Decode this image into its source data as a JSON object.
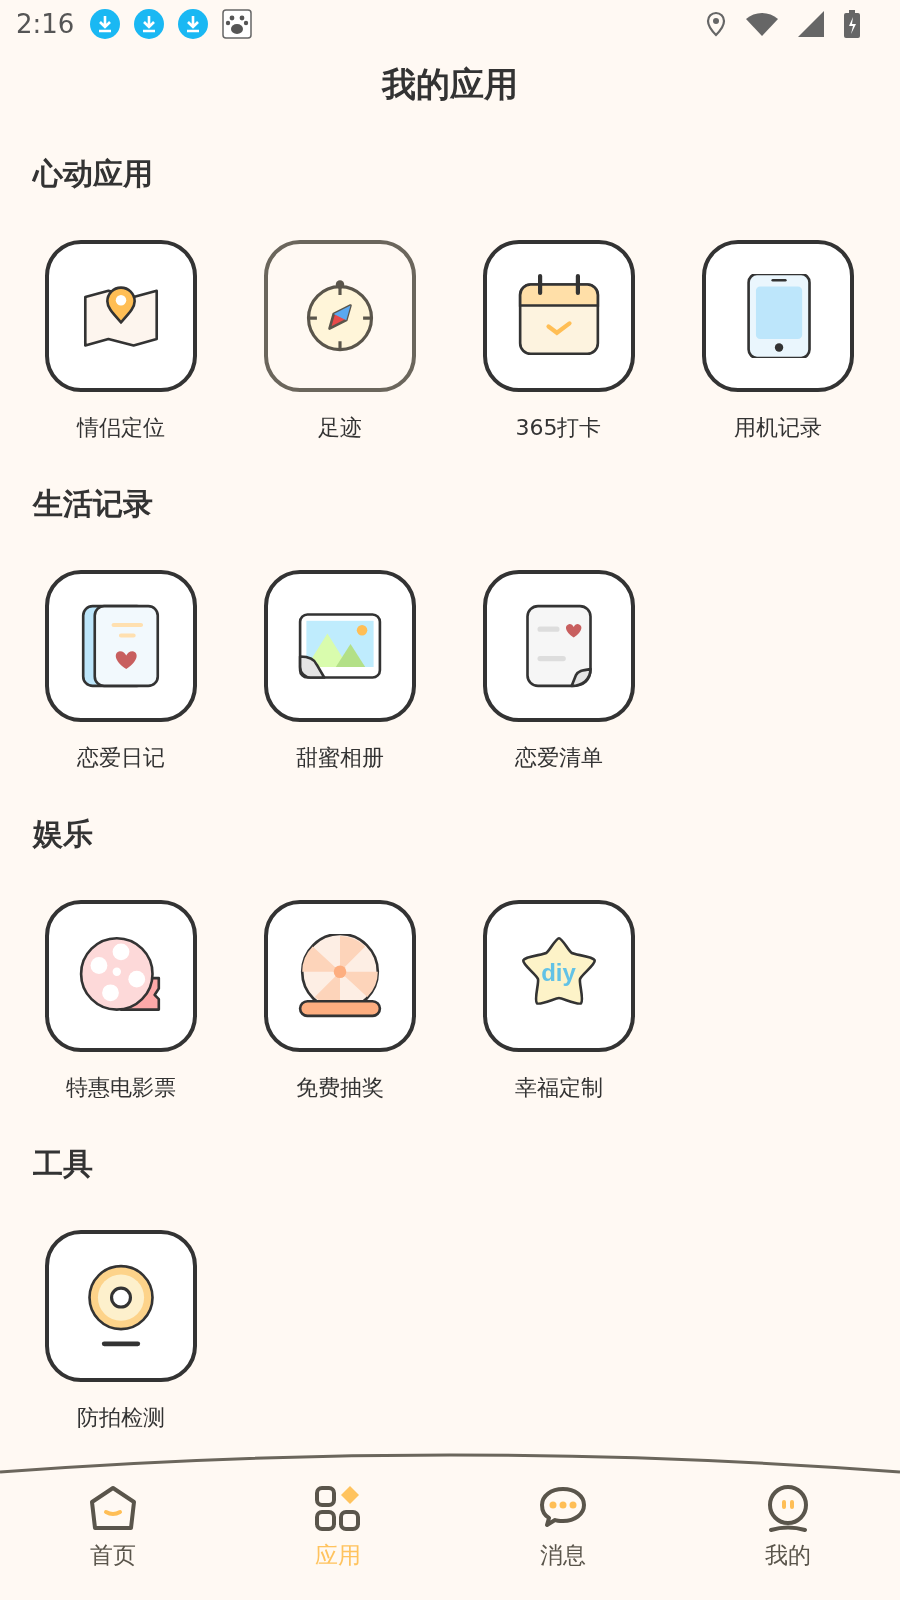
{
  "status_bar": {
    "time": "2:16"
  },
  "title": "我的应用",
  "sections": [
    {
      "title": "心动应用",
      "apps": [
        {
          "label": "情侣定位",
          "pressed": false
        },
        {
          "label": "足迹",
          "pressed": true
        },
        {
          "label": "365打卡",
          "pressed": false
        },
        {
          "label": "用机记录",
          "pressed": false
        }
      ]
    },
    {
      "title": "生活记录",
      "apps": [
        {
          "label": "恋爱日记",
          "pressed": false
        },
        {
          "label": "甜蜜相册",
          "pressed": false
        },
        {
          "label": "恋爱清单",
          "pressed": false
        }
      ]
    },
    {
      "title": "娱乐",
      "apps": [
        {
          "label": "特惠电影票",
          "pressed": false
        },
        {
          "label": "免费抽奖",
          "pressed": false
        },
        {
          "label": "幸福定制",
          "badge_text": "diy",
          "pressed": false
        }
      ]
    },
    {
      "title": "工具",
      "apps": [
        {
          "label": "防拍检测",
          "pressed": false
        }
      ]
    }
  ],
  "tabs": [
    {
      "label": "首页",
      "selected": false
    },
    {
      "label": "应用",
      "selected": true
    },
    {
      "label": "消息",
      "selected": false
    },
    {
      "label": "我的",
      "selected": false
    }
  ]
}
